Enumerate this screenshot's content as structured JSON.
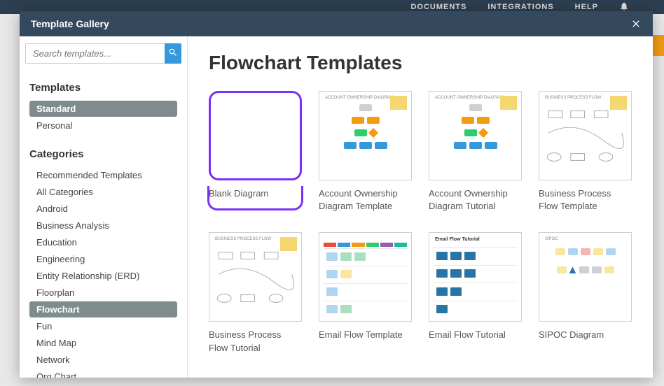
{
  "topnav": {
    "items": [
      "DOCUMENTS",
      "INTEGRATIONS",
      "HELP"
    ]
  },
  "modal": {
    "title": "Template Gallery"
  },
  "search": {
    "placeholder": "Search templates..."
  },
  "sidebar": {
    "heading_templates": "Templates",
    "template_tabs": [
      {
        "label": "Standard",
        "active": true
      },
      {
        "label": "Personal",
        "active": false
      }
    ],
    "heading_categories": "Categories",
    "categories": [
      {
        "label": "Recommended Templates",
        "active": false
      },
      {
        "label": "All Categories",
        "active": false
      },
      {
        "label": "Android",
        "active": false
      },
      {
        "label": "Business Analysis",
        "active": false
      },
      {
        "label": "Education",
        "active": false
      },
      {
        "label": "Engineering",
        "active": false
      },
      {
        "label": "Entity Relationship (ERD)",
        "active": false
      },
      {
        "label": "Floorplan",
        "active": false
      },
      {
        "label": "Flowchart",
        "active": true
      },
      {
        "label": "Fun",
        "active": false
      },
      {
        "label": "Mind Map",
        "active": false
      },
      {
        "label": "Network",
        "active": false
      },
      {
        "label": "Org Chart",
        "active": false
      }
    ]
  },
  "content": {
    "title": "Flowchart Templates",
    "templates": [
      {
        "label": "Blank Diagram",
        "highlighted": true,
        "thumb": "blank"
      },
      {
        "label": "Account Ownership Diagram Template",
        "highlighted": false,
        "thumb": "account"
      },
      {
        "label": "Account Ownership Diagram Tutorial",
        "highlighted": false,
        "thumb": "account"
      },
      {
        "label": "Business Process Flow Template",
        "highlighted": false,
        "thumb": "bizflow"
      },
      {
        "label": "Business Process Flow Tutorial",
        "highlighted": false,
        "thumb": "bizflow"
      },
      {
        "label": "Email Flow Template",
        "highlighted": false,
        "thumb": "email"
      },
      {
        "label": "Email Flow Tutorial",
        "highlighted": false,
        "thumb": "emailtut"
      },
      {
        "label": "SIPOC Diagram",
        "highlighted": false,
        "thumb": "sipoc"
      }
    ]
  }
}
